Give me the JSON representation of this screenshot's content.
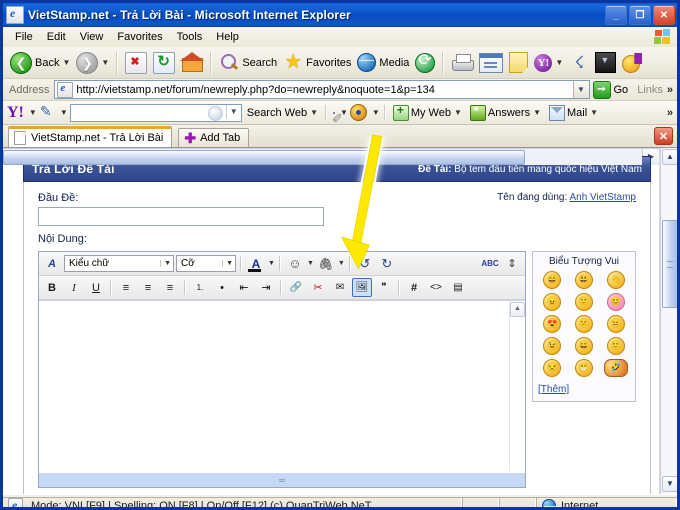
{
  "window": {
    "title": "VietStamp.net - Trả Lời Bài - Microsoft Internet Explorer",
    "minimize": "_",
    "restore": "❐",
    "close": "✕"
  },
  "menu": {
    "items": [
      "File",
      "Edit",
      "View",
      "Favorites",
      "Tools",
      "Help"
    ]
  },
  "toolbar": {
    "back": "Back",
    "forward": "",
    "stop": "",
    "refresh": "",
    "home": "",
    "search": "Search",
    "favorites": "Favorites",
    "media": "Media",
    "history": "",
    "print": "",
    "edit": "",
    "discuss": "",
    "messenger": "",
    "research": "",
    "download": "",
    "yahoo_smiley": ""
  },
  "address": {
    "label": "Address",
    "url": "http://vietstamp.net/forum/newreply.php?do=newreply&noquote=1&p=134",
    "go": "Go",
    "links": "Links",
    "chevron": "»"
  },
  "yahoo_toolbar": {
    "logo": "Y!",
    "search_value": "",
    "search_web": "Search Web",
    "my_web": "My Web",
    "answers": "Answers",
    "mail": "Mail",
    "overflow": "»"
  },
  "tabs": {
    "items": [
      {
        "label": "VietStamp.net - Trả Lời Bài",
        "active": true
      }
    ],
    "add_tab": "Add Tab",
    "close": "✕"
  },
  "page": {
    "header": {
      "left": "Trả Lời Đề Tài",
      "right_label": "Đề Tài:",
      "right_value": "Bộ tem đầu tiên mang quốc hiệu Việt Nam"
    },
    "form": {
      "title_label": "Đầu Đề:",
      "title_value": "",
      "body_label": "Nội Dung:",
      "username_label": "Tên đang dùng:",
      "username_value": "Anh VietStamp"
    },
    "editor": {
      "row1": {
        "font_style_icon": "A",
        "font_family_label": "Kiểu chữ",
        "font_size_label": "Cỡ",
        "color_label": "A",
        "smiley": "☺",
        "attach": "🖇",
        "undo": "↺",
        "redo": "↻",
        "spellcheck": "ABC",
        "expand": "⇕"
      },
      "row2": {
        "bold": "B",
        "italic": "I",
        "underline": "U",
        "align_left": "≡",
        "align_center": "≡",
        "align_right": "≡",
        "ordered_list": "1.",
        "unordered_list": "•",
        "outdent": "⇤",
        "indent": "⇥",
        "link": "🔗",
        "unlink": "✂",
        "email": "✉",
        "image": "🖼",
        "quote": "❞",
        "code_hash": "#",
        "code_tag": "<>",
        "php": "▤"
      },
      "content": ""
    },
    "smilies": {
      "title": "Biểu Tượng Vui",
      "items": [
        {
          "name": "laugh",
          "glyph": "😄",
          "style": "normal"
        },
        {
          "name": "big-grin",
          "glyph": "😃",
          "style": "normal"
        },
        {
          "name": "wave",
          "glyph": "👋",
          "style": "normal"
        },
        {
          "name": "angry",
          "glyph": "😠",
          "style": "normal"
        },
        {
          "name": "smile",
          "glyph": "🙂",
          "style": "normal"
        },
        {
          "name": "blush",
          "glyph": "😊",
          "style": "pink"
        },
        {
          "name": "love",
          "glyph": "😍",
          "style": "normal"
        },
        {
          "name": "confused",
          "glyph": "😕",
          "style": "normal"
        },
        {
          "name": "neutral",
          "glyph": "😐",
          "style": "normal"
        },
        {
          "name": "wink",
          "glyph": "😉",
          "style": "normal"
        },
        {
          "name": "happy",
          "glyph": "😀",
          "style": "normal"
        },
        {
          "name": "plain",
          "glyph": "🙂",
          "style": "normal"
        },
        {
          "name": "unamused",
          "glyph": "😒",
          "style": "normal"
        },
        {
          "name": "teeth",
          "glyph": "😁",
          "style": "normal"
        },
        {
          "name": "rofl",
          "glyph": "🤣",
          "style": "wide"
        }
      ],
      "more": "[Thêm]"
    }
  },
  "statusbar": {
    "text": "Mode: VNI [F9] | Spelling: ON [F8] | On/Off [F12] (c) QuanTriWeb.NeT",
    "zone": "Internet"
  },
  "annotation": {
    "type": "yellow-arrow",
    "color": "#FFE800",
    "points_to": "insert-image-button"
  },
  "colors": {
    "titlebar": "#0a4ec0",
    "page_header": "#3b5496",
    "accent_tab": "#e8a33d",
    "link": "#2a4aa8",
    "annotation": "#FFE800"
  }
}
